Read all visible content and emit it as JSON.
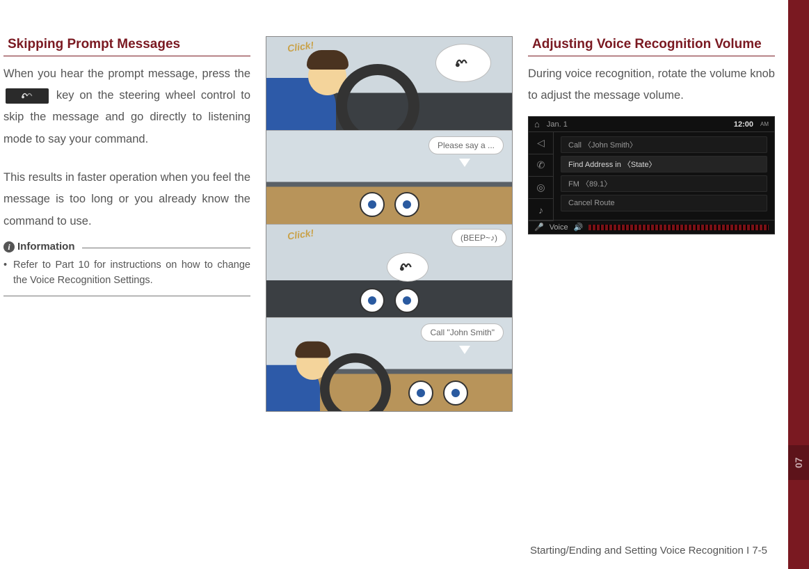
{
  "sideTab": {
    "number": "07"
  },
  "col1": {
    "heading": "Skipping Prompt Messages",
    "para1a": "When you hear the prompt message, press the ",
    "para1b": " key on the steering wheel control to skip the message and go directly to listening mode to say your command.",
    "para2": "This results in faster operation when you feel the message is too long or you already know the command to use.",
    "infoLabel": "Information",
    "infoBullet": "Refer to Part 10 for instructions on how to change the Voice Recognition Settings."
  },
  "comic": {
    "click": "Click!",
    "bubble2": "Please say a ...",
    "bubble3": "(BEEP~♪)",
    "bubble4": "Call \"John Smith\""
  },
  "col3": {
    "heading": "Adjusting Voice Recognition Volume",
    "para": "During voice recognition, rotate the volume knob to adjust the message volume."
  },
  "screen": {
    "date": "Jan. 1",
    "time": "12:00",
    "ampm": "AM",
    "rows": [
      "Call 〈John Smith〉",
      "Find Address in 〈State〉",
      "FM 〈89.1〉",
      "Cancel Route"
    ],
    "voiceLabel": "Voice"
  },
  "footer": "Starting/Ending and Setting Voice Recognition I 7-5"
}
